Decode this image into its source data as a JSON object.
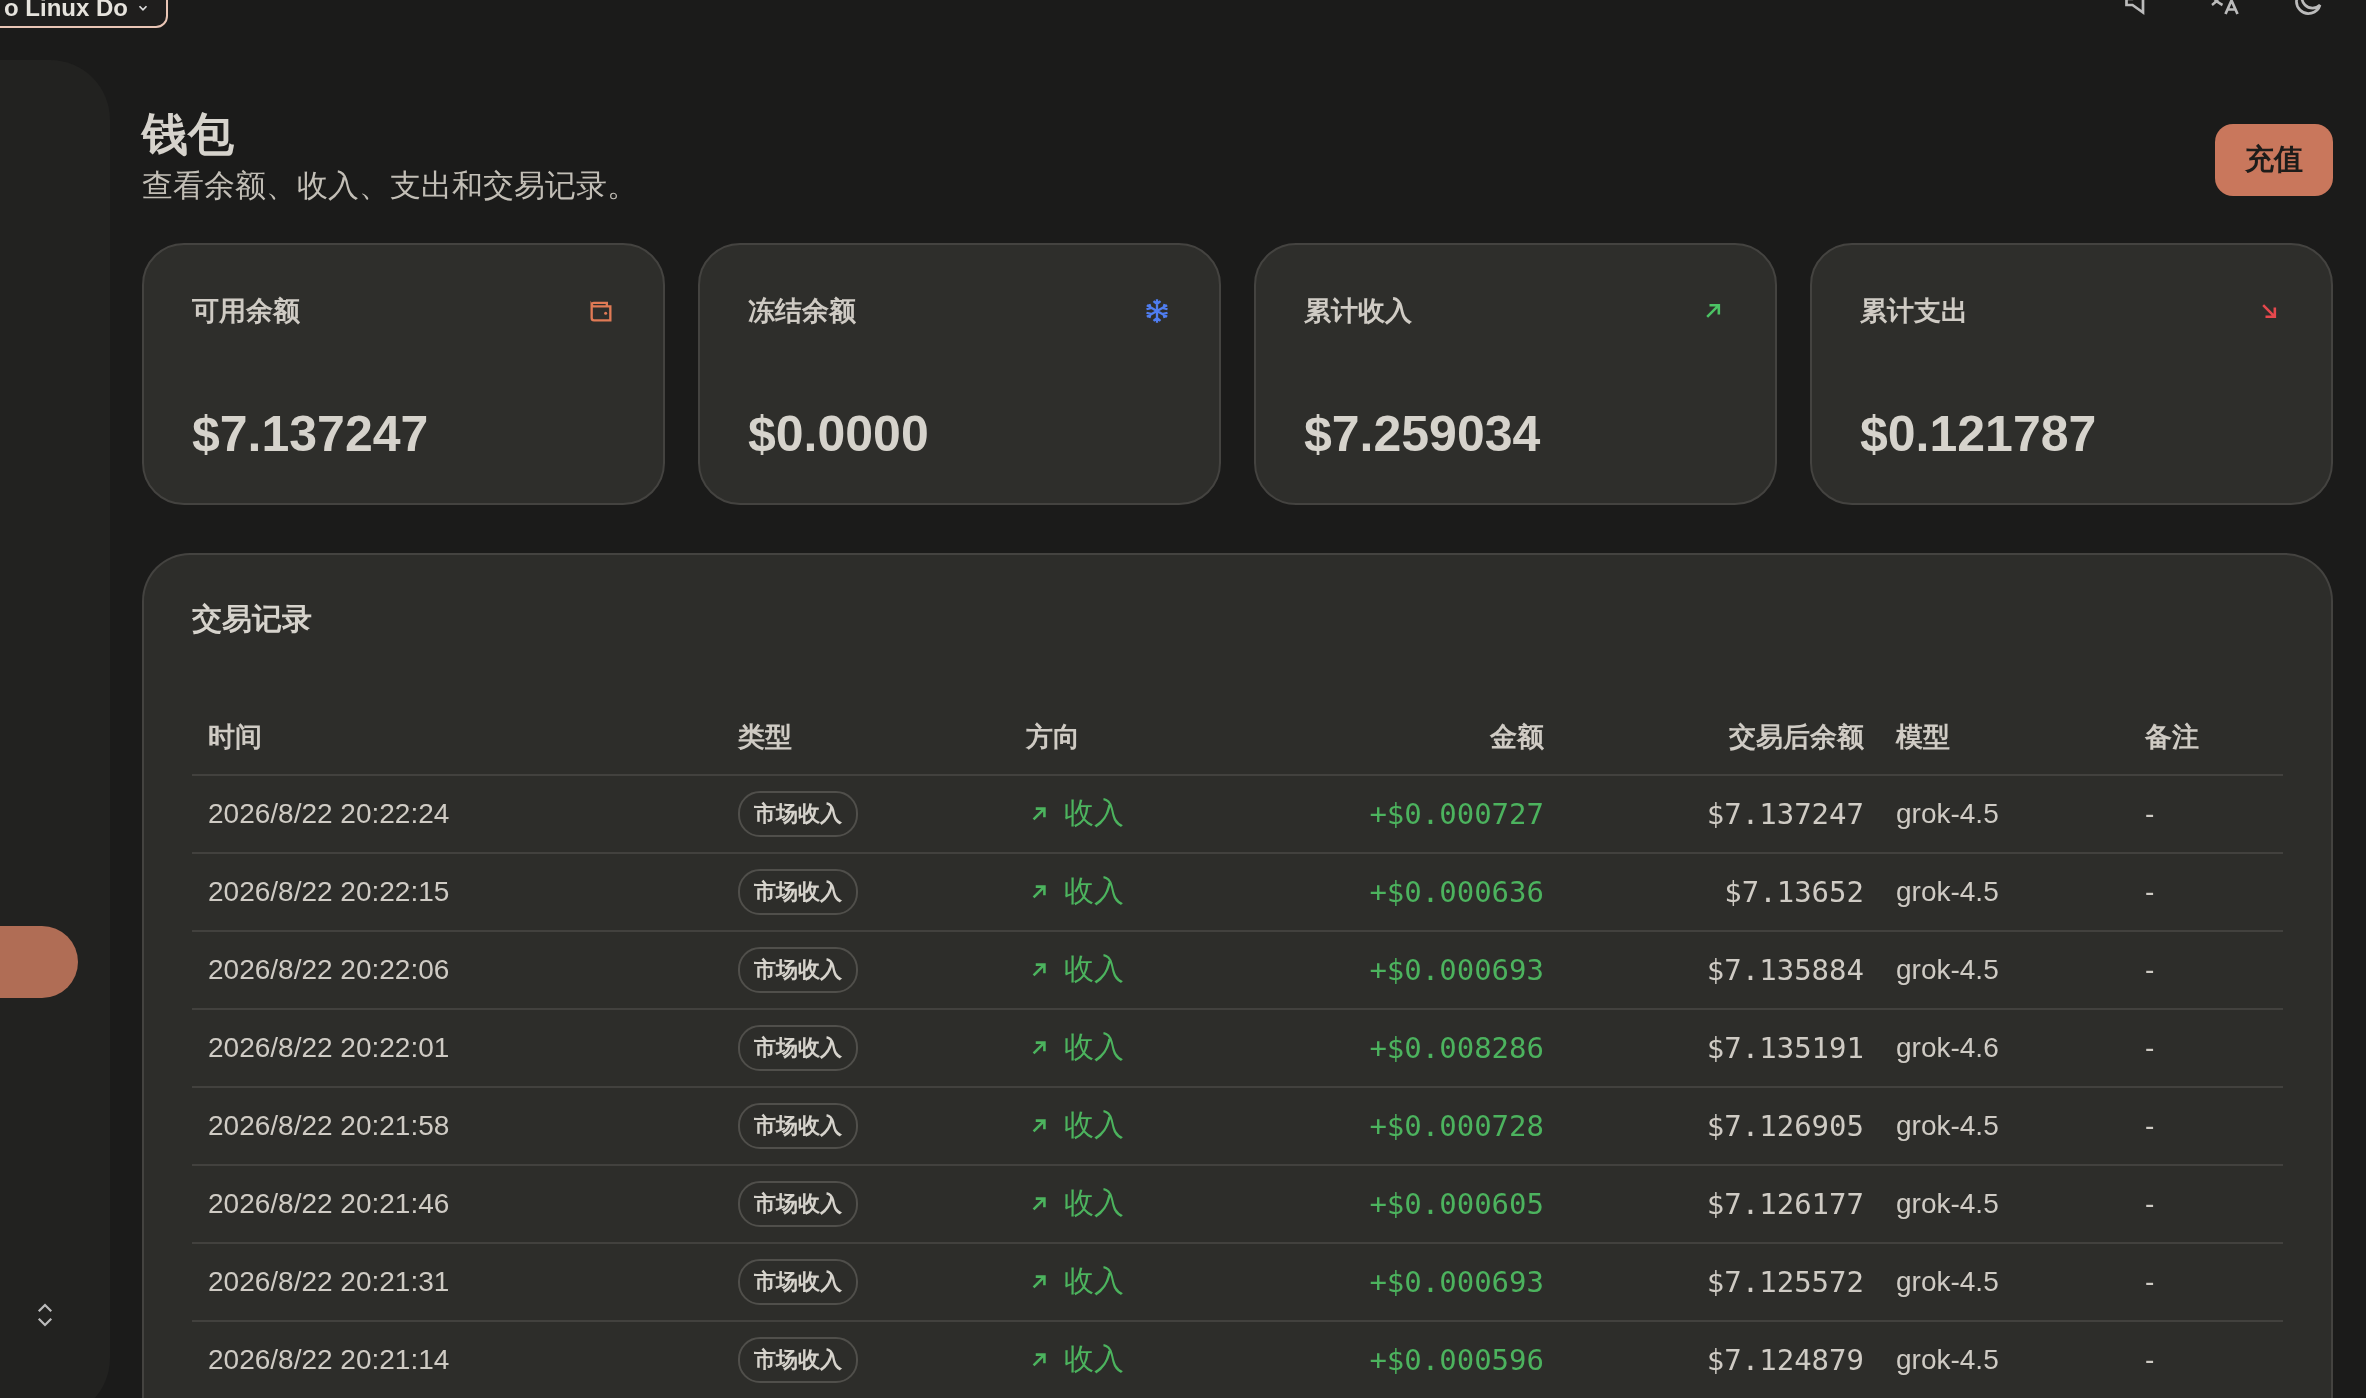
{
  "top_bar": {
    "workspace": "o Linux Do"
  },
  "page": {
    "title": "钱包",
    "subtitle": "查看余额、收入、支出和交易记录。",
    "recharge_button": "充值"
  },
  "cards": [
    {
      "kind": "wallet",
      "label": "可用余额",
      "value": "$7.137247"
    },
    {
      "kind": "frozen",
      "label": "冻结余额",
      "value": "$0.0000"
    },
    {
      "kind": "income",
      "label": "累计收入",
      "value": "$7.259034"
    },
    {
      "kind": "expense",
      "label": "累计支出",
      "value": "$0.121787"
    }
  ],
  "transactions": {
    "title": "交易记录",
    "columns": [
      "时间",
      "类型",
      "方向",
      "金额",
      "交易后余额",
      "模型",
      "备注"
    ],
    "rows": [
      {
        "time": "2026/8/22 20:22:24",
        "type": "市场收入",
        "kind": "income",
        "direction": "收入",
        "amount": "+$0.000727",
        "balance": "$7.137247",
        "model": "grok-4.5",
        "note": "-"
      },
      {
        "time": "2026/8/22 20:22:15",
        "type": "市场收入",
        "kind": "income",
        "direction": "收入",
        "amount": "+$0.000636",
        "balance": "$7.13652",
        "model": "grok-4.5",
        "note": "-"
      },
      {
        "time": "2026/8/22 20:22:06",
        "type": "市场收入",
        "kind": "income",
        "direction": "收入",
        "amount": "+$0.000693",
        "balance": "$7.135884",
        "model": "grok-4.5",
        "note": "-"
      },
      {
        "time": "2026/8/22 20:22:01",
        "type": "市场收入",
        "kind": "income",
        "direction": "收入",
        "amount": "+$0.008286",
        "balance": "$7.135191",
        "model": "grok-4.6",
        "note": "-"
      },
      {
        "time": "2026/8/22 20:21:58",
        "type": "市场收入",
        "kind": "income",
        "direction": "收入",
        "amount": "+$0.000728",
        "balance": "$7.126905",
        "model": "grok-4.5",
        "note": "-"
      },
      {
        "time": "2026/8/22 20:21:46",
        "type": "市场收入",
        "kind": "income",
        "direction": "收入",
        "amount": "+$0.000605",
        "balance": "$7.126177",
        "model": "grok-4.5",
        "note": "-"
      },
      {
        "time": "2026/8/22 20:21:31",
        "type": "市场收入",
        "kind": "income",
        "direction": "收入",
        "amount": "+$0.000693",
        "balance": "$7.125572",
        "model": "grok-4.5",
        "note": "-"
      },
      {
        "time": "2026/8/22 20:21:14",
        "type": "市场收入",
        "kind": "income",
        "direction": "收入",
        "amount": "+$0.000596",
        "balance": "$7.124879",
        "model": "grok-4.5",
        "note": "-"
      }
    ]
  }
}
